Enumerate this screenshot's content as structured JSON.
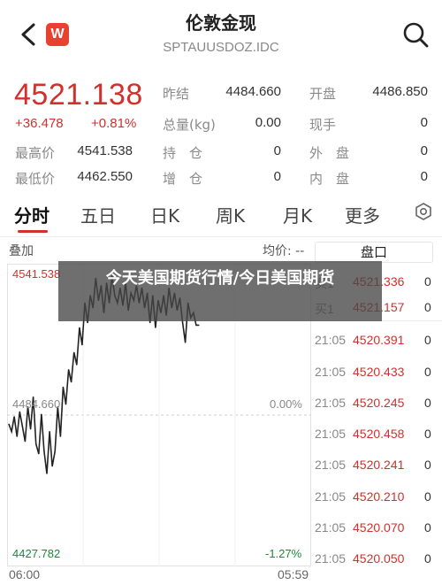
{
  "header": {
    "title": "伦敦金现",
    "symbol": "SPTAUUSDOZ.IDC",
    "logo_letter": "W",
    "back_icon": "chevron-left-icon",
    "search_icon": "search-icon"
  },
  "quote": {
    "price": "4521.138",
    "change": "+36.478",
    "change_pct": "+0.81%",
    "labels": {
      "prev_close": "昨结",
      "open": "开盘",
      "volume": "总量(kg)",
      "hand": "现手",
      "high": "最高价",
      "low": "最低价",
      "hold": "持　仓",
      "add": "增　仓",
      "outer": "外　盘",
      "inner": "内　盘"
    },
    "values": {
      "prev_close": "4484.660",
      "open": "4486.850",
      "volume": "0.00",
      "hand": "0",
      "high": "4541.538",
      "low": "4462.550",
      "hold": "0",
      "add": "0",
      "outer": "0",
      "inner": "0"
    }
  },
  "tabs": [
    "分时",
    "五日",
    "日K",
    "周K",
    "月K",
    "更多"
  ],
  "active_tab": "分时",
  "chart_labels": {
    "left_top": "叠加",
    "avg": "均价: --",
    "max": "4541.538",
    "mid": "4484.660",
    "min": "4427.782",
    "mid_pct": "0.00%",
    "min_pct": "-1.27%",
    "time_start": "06:00",
    "time_end": "05:59"
  },
  "chart_data": {
    "type": "line",
    "ylim": [
      4427.782,
      4541.538
    ],
    "x": [
      0,
      1,
      2,
      3,
      4,
      5,
      6,
      7,
      8,
      9,
      10,
      11,
      12,
      13,
      14,
      15,
      16,
      17,
      18,
      19,
      20,
      21,
      22,
      23,
      24,
      25,
      26,
      27,
      28,
      29,
      30,
      31,
      32,
      33,
      34,
      35,
      36,
      37,
      38,
      39,
      40,
      41,
      42,
      43,
      44,
      45,
      46,
      47,
      48,
      49,
      50,
      51,
      52,
      53,
      54,
      55,
      56,
      57,
      58,
      59,
      60,
      61,
      62,
      63,
      64,
      65,
      66,
      67,
      68,
      69,
      70
    ],
    "y": [
      4481,
      4478,
      4484,
      4476,
      4486,
      4480,
      4474,
      4488,
      4479,
      4492,
      4473,
      4469,
      4485,
      4470,
      4461,
      4478,
      4464,
      4470,
      4488,
      4476,
      4496,
      4489,
      4503,
      4498,
      4510,
      4505,
      4520,
      4513,
      4530,
      4522,
      4533,
      4528,
      4540,
      4531,
      4537,
      4526,
      4538,
      4530,
      4541,
      4533,
      4530,
      4536,
      4529,
      4538,
      4527,
      4534,
      4531,
      4537,
      4530,
      4536,
      4528,
      4534,
      4522,
      4533,
      4520,
      4531,
      4526,
      4533,
      4525,
      4536,
      4528,
      4534,
      4527,
      4532,
      4522,
      4514,
      4530,
      4524,
      4526,
      4521,
      4521
    ]
  },
  "order_book": {
    "title": "盘口",
    "asks": [
      {
        "label": "卖1",
        "price": "4521.336",
        "vol": "0"
      },
      {
        "label": "买1",
        "price": "4521.157",
        "vol": "0"
      }
    ],
    "trades": [
      {
        "time": "21:05",
        "price": "4520.391",
        "vol": "0"
      },
      {
        "time": "21:05",
        "price": "4520.433",
        "vol": "0"
      },
      {
        "time": "21:05",
        "price": "4520.245",
        "vol": "0"
      },
      {
        "time": "21:05",
        "price": "4520.458",
        "vol": "0"
      },
      {
        "time": "21:05",
        "price": "4520.241",
        "vol": "0"
      },
      {
        "time": "21:05",
        "price": "4520.210",
        "vol": "0"
      },
      {
        "time": "21:05",
        "price": "4520.070",
        "vol": "0"
      },
      {
        "time": "21:05",
        "price": "4520.050",
        "vol": "0"
      }
    ]
  },
  "overlay": {
    "text": "今天美国期货行情/今日美国期货"
  },
  "colors": {
    "up": "#d0312d",
    "down": "#1a8a3a",
    "line": "#222222"
  }
}
